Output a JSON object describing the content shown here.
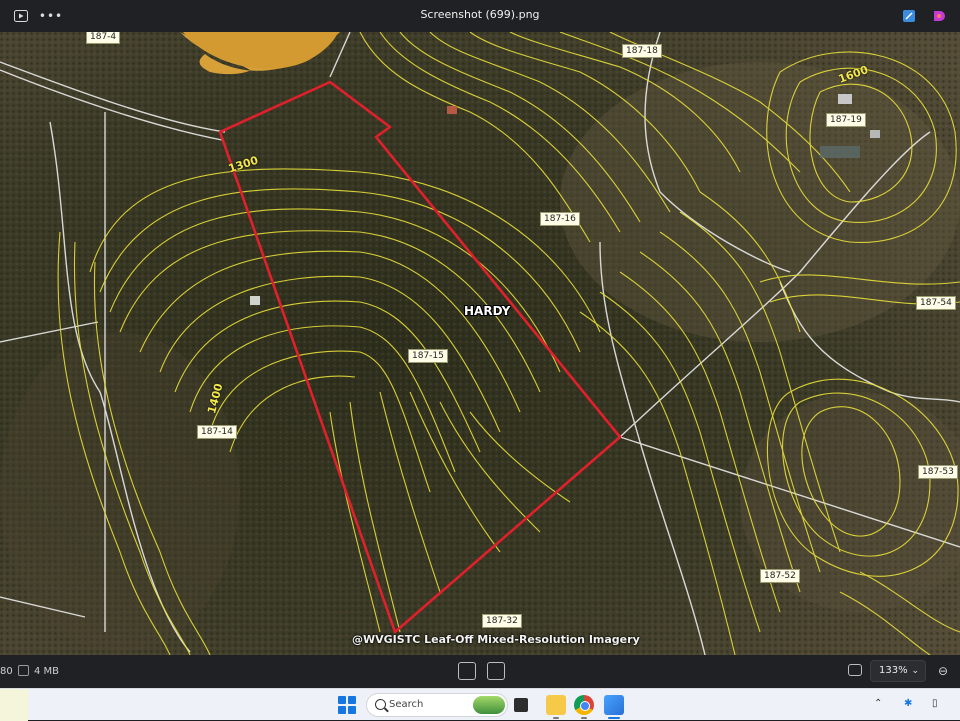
{
  "window": {
    "title": "Screenshot (699).png",
    "icons": {
      "slideshow": "slideshow-icon",
      "more": "more-icon",
      "edit": "edit-image-icon",
      "designer": "designer-icon"
    },
    "more_glyph": "•••"
  },
  "map": {
    "owner_label": "HARDY",
    "watermark": "@WVGISTC Leaf-Off Mixed-Resolution Imagery",
    "parcels": [
      "187-4",
      "187-18",
      "187-19",
      "187-16",
      "187-54",
      "187-15",
      "187-14",
      "187-53",
      "187-52",
      "187-32"
    ],
    "contours": [
      "1600",
      "1300",
      "1400"
    ],
    "colors": {
      "boundary": "#e0202a",
      "contour": "#e8df3a",
      "pond": "#e0a53a",
      "road": "#e9e9e9"
    }
  },
  "statusbar": {
    "dimensions_fragment": "80",
    "file_size": "4 MB",
    "zoom": "133%",
    "icons": {
      "file_info": "info-box-icon",
      "face": "face-detect-icon",
      "ocr": "text-scan-icon",
      "fit": "fit-to-window-icon",
      "zoom_dropdown": "chevron-down-icon",
      "zoom_out": "zoom-out-icon"
    }
  },
  "taskbar": {
    "search_placeholder": "Search",
    "apps": [
      "start-icon",
      "task-view-icon",
      "file-explorer-icon",
      "chrome-icon",
      "photos-icon"
    ],
    "tray": [
      "chevron-up-icon",
      "bluetooth-icon",
      "battery-icon"
    ]
  }
}
